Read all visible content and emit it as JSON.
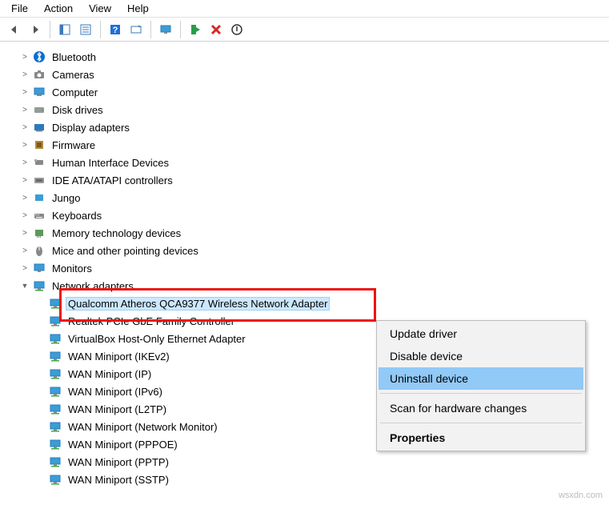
{
  "menu": {
    "file": "File",
    "action": "Action",
    "view": "View",
    "help": "Help"
  },
  "tree": {
    "bluetooth": "Bluetooth",
    "cameras": "Cameras",
    "computer": "Computer",
    "diskdrives": "Disk drives",
    "displayadapters": "Display adapters",
    "firmware": "Firmware",
    "hid": "Human Interface Devices",
    "ide": "IDE ATA/ATAPI controllers",
    "jungo": "Jungo",
    "keyboards": "Keyboards",
    "memtech": "Memory technology devices",
    "mice": "Mice and other pointing devices",
    "monitors": "Monitors",
    "network": "Network adapters",
    "net_items": [
      "Qualcomm Atheros QCA9377 Wireless Network Adapter",
      "Realtek PCIe GbE Family Controller",
      "VirtualBox Host-Only Ethernet Adapter",
      "WAN Miniport (IKEv2)",
      "WAN Miniport (IP)",
      "WAN Miniport (IPv6)",
      "WAN Miniport (L2TP)",
      "WAN Miniport (Network Monitor)",
      "WAN Miniport (PPPOE)",
      "WAN Miniport (PPTP)",
      "WAN Miniport (SSTP)"
    ]
  },
  "context": {
    "update": "Update driver",
    "disable": "Disable device",
    "uninstall": "Uninstall device",
    "scan": "Scan for hardware changes",
    "properties": "Properties"
  },
  "watermark": "wsxdn.com"
}
